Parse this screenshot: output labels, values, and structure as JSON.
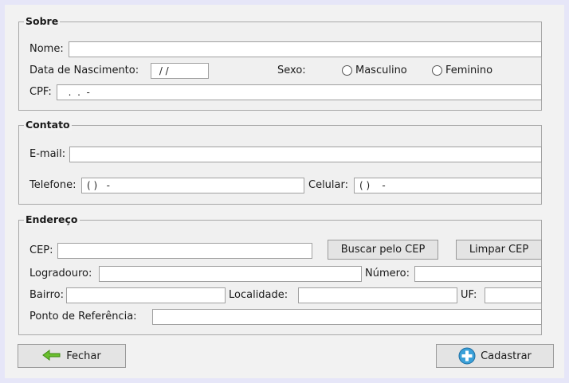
{
  "sobre": {
    "legend": "Sobre",
    "nome_label": "Nome:",
    "nome_value": "",
    "nascimento_label": "Data de Nascimento:",
    "nascimento_value": " / /",
    "sexo_label": "Sexo:",
    "masculino_label": "Masculino",
    "feminino_label": "Feminino",
    "cpf_label": "CPF:",
    "cpf_value": "  .  .  -"
  },
  "contato": {
    "legend": "Contato",
    "email_label": "E-mail:",
    "email_value": "",
    "telefone_label": "Telefone:",
    "telefone_value": "( )   -",
    "celular_label": "Celular:",
    "celular_value": "( )    -"
  },
  "endereco": {
    "legend": "Endereço",
    "cep_label": "CEP:",
    "cep_value": "",
    "buscar_cep_label": "Buscar pelo CEP",
    "limpar_cep_label": "Limpar CEP",
    "logradouro_label": "Logradouro:",
    "logradouro_value": "",
    "numero_label": "Número:",
    "numero_value": "",
    "bairro_label": "Bairro:",
    "bairro_value": "",
    "localidade_label": "Localidade:",
    "localidade_value": "",
    "uf_label": "UF:",
    "uf_value": "",
    "referencia_label": "Ponto de Referência:",
    "referencia_value": ""
  },
  "actions": {
    "fechar_label": "Fechar",
    "fechar_icon": "arrow-left-icon",
    "cadastrar_label": "Cadastrar",
    "cadastrar_icon": "plus-circle-icon",
    "accent_green": "#6abf2e",
    "accent_blue": "#3aa0d8"
  }
}
